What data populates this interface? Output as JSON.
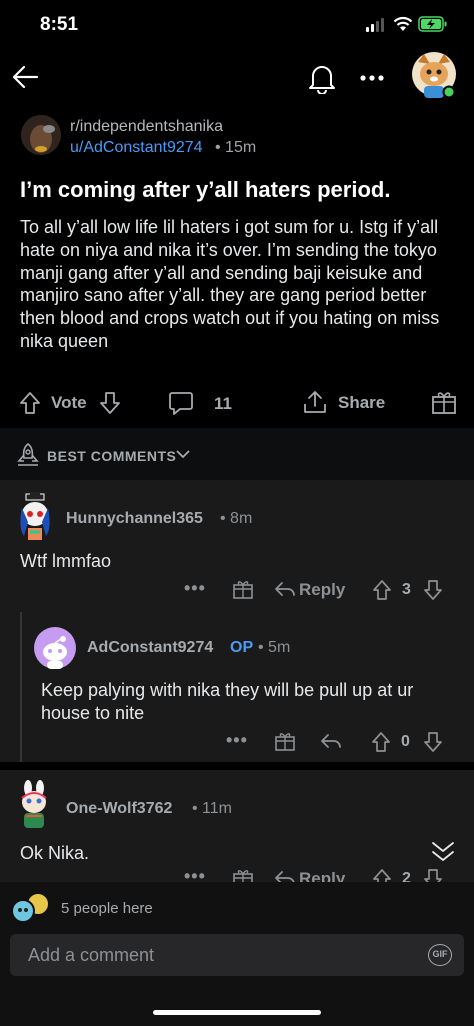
{
  "status": {
    "time": "8:51"
  },
  "post": {
    "subreddit": "r/independentshanika",
    "author": "u/AdConstant9274",
    "age": "• 15m",
    "title": "I’m coming after y’all haters period.",
    "body": "To all y’all low life lil haters i got sum for u. Istg if y’all hate on niya and nika it’s over. I’m sending the tokyo manji gang after y’all and sending baji keisuke and manjiro sano after y’all. they are gang period better then blood and crops watch out if you hating on miss nika queen",
    "vote_label": "Vote",
    "comment_count": "11",
    "share_label": "Share"
  },
  "sort": {
    "label": "BEST COMMENTS"
  },
  "comments": [
    {
      "user": "Hunnychannel365",
      "age": "• 8m",
      "text": "Wtf lmmfao",
      "reply_label": "Reply",
      "votes": "3"
    },
    {
      "user": "AdConstant9274",
      "op": "OP",
      "age": "• 5m",
      "text": "Keep palying with nika they will be pull up at ur house to nite",
      "votes": "0"
    },
    {
      "user": "One-Wolf3762",
      "age": "• 11m",
      "text": "Ok Nika.",
      "reply_label": "Reply",
      "votes": "2"
    }
  ],
  "presence": {
    "text": "5 people here"
  },
  "composer": {
    "placeholder": "Add a comment",
    "gif_label": "GIF"
  },
  "colors": {
    "link": "#4a9bf5",
    "op": "#4a9bf5",
    "online": "#46d160",
    "battery": "#4cd964"
  }
}
